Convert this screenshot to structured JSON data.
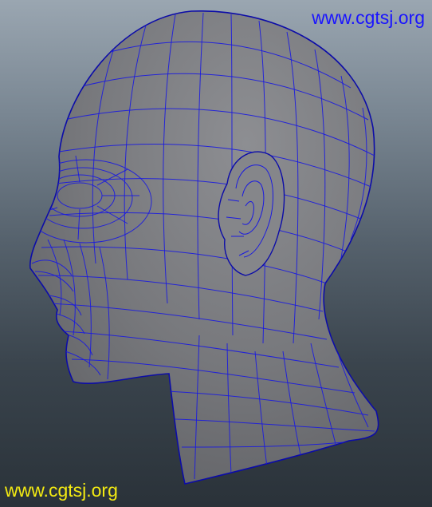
{
  "viewport": {
    "model": "head-mesh-wireframe",
    "background_top": "#9aa6b1",
    "background_bottom": "#2a3239",
    "surface_color": "#7b7c80",
    "wire_color": "#1a1ae0"
  },
  "watermarks": {
    "top_right": "www.cgtsj.org",
    "bottom_left": "www.cgtsj.org",
    "top_right_color": "#1a14ff",
    "bottom_left_color": "#f3ea12"
  }
}
